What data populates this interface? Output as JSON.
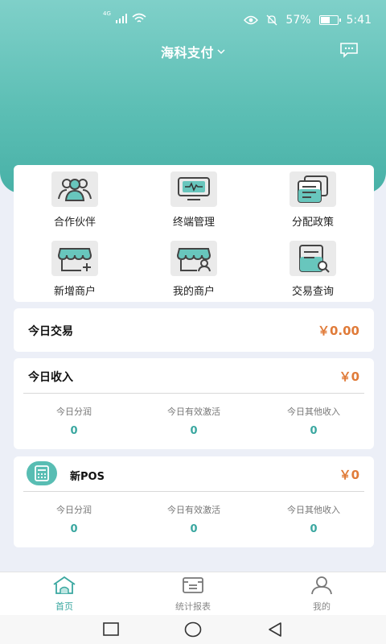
{
  "status_bar": {
    "network_tag": "4G",
    "battery_percent": "57%",
    "battery_level": 0.57,
    "time": "5:41",
    "icons": [
      "signal-icon",
      "wifi-icon",
      "eye-icon",
      "mute-icon",
      "battery-icon"
    ]
  },
  "header": {
    "title": "海科支付",
    "dropdown_icon": "chevron-down-icon",
    "message_icon": "chat-icon"
  },
  "menu": {
    "items": [
      {
        "label": "合作伙伴",
        "icon": "partners-icon"
      },
      {
        "label": "终端管理",
        "icon": "terminal-icon"
      },
      {
        "label": "分配政策",
        "icon": "policy-icon"
      },
      {
        "label": "新增商户",
        "icon": "add-merchant-icon"
      },
      {
        "label": "我的商户",
        "icon": "my-merchant-icon"
      },
      {
        "label": "交易查询",
        "icon": "transaction-query-icon"
      }
    ]
  },
  "today_trade": {
    "title": "今日交易",
    "amount": "￥0.00"
  },
  "today_income": {
    "title": "今日收入",
    "amount": "￥0",
    "stats": [
      {
        "label": "今日分润",
        "value": "0"
      },
      {
        "label": "今日有效激活",
        "value": "0"
      },
      {
        "label": "今日其他收入",
        "value": "0"
      }
    ]
  },
  "new_pos": {
    "title": "新POS",
    "amount": "￥0",
    "icon": "calculator-icon",
    "stats": [
      {
        "label": "今日分润",
        "value": "0"
      },
      {
        "label": "今日有效激活",
        "value": "0"
      },
      {
        "label": "今日其他收入",
        "value": "0"
      }
    ]
  },
  "tabs": [
    {
      "label": "首页",
      "icon": "home-icon",
      "active": true
    },
    {
      "label": "统计报表",
      "icon": "report-icon",
      "active": false
    },
    {
      "label": "我的",
      "icon": "user-icon",
      "active": false
    }
  ],
  "system_nav": {
    "icons": [
      "square-nav-icon",
      "circle-nav-icon",
      "back-nav-icon"
    ]
  },
  "colors": {
    "brand_teal": "#5dbfb5",
    "accent_orange": "#e07b39",
    "value_teal": "#3aa7a0",
    "background": "#eceff7"
  }
}
